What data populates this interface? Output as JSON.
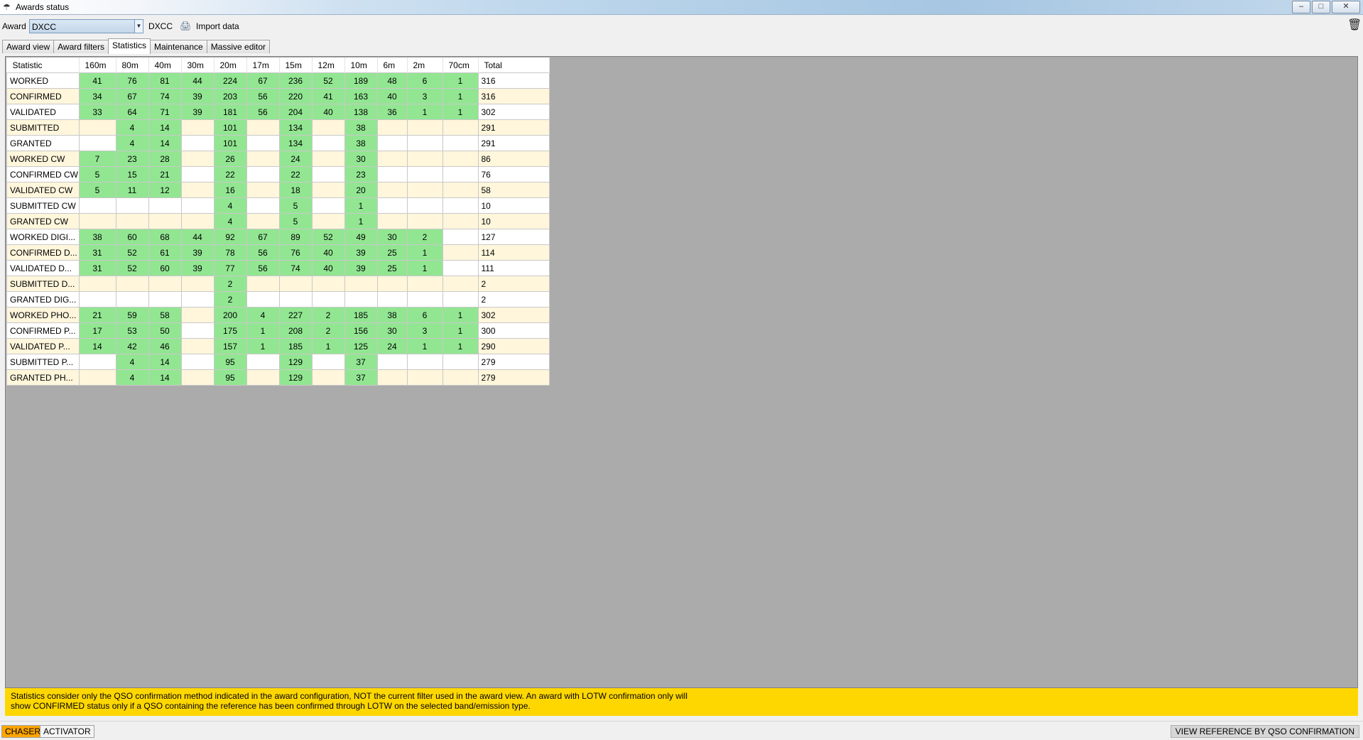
{
  "window": {
    "title": "Awards status"
  },
  "toolbar": {
    "award_label": "Award",
    "award_value": "DXCC",
    "award_name": "DXCC",
    "import_label": "Import data"
  },
  "tabs": [
    "Award view",
    "Award filters",
    "Statistics",
    "Maintenance",
    "Massive editor"
  ],
  "active_tab": "Statistics",
  "colors": {
    "confirmed_green": "#92e692",
    "stripe_cream": "#fff6dc",
    "info_yellow": "#ffd700",
    "chaser_orange": "#ffa500"
  },
  "table": {
    "columns": [
      "Statistic",
      "160m",
      "80m",
      "40m",
      "30m",
      "20m",
      "17m",
      "15m",
      "12m",
      "10m",
      "6m",
      "2m",
      "70cm",
      "Total"
    ],
    "rows": [
      {
        "name": "WORKED",
        "cells": [
          "41",
          "76",
          "81",
          "44",
          "224",
          "67",
          "236",
          "52",
          "189",
          "48",
          "6",
          "1"
        ],
        "total": "316"
      },
      {
        "name": "CONFIRMED",
        "cells": [
          "34",
          "67",
          "74",
          "39",
          "203",
          "56",
          "220",
          "41",
          "163",
          "40",
          "3",
          "1"
        ],
        "total": "316"
      },
      {
        "name": "VALIDATED",
        "cells": [
          "33",
          "64",
          "71",
          "39",
          "181",
          "56",
          "204",
          "40",
          "138",
          "36",
          "1",
          "1"
        ],
        "total": "302"
      },
      {
        "name": "SUBMITTED",
        "cells": [
          "",
          "4",
          "14",
          "",
          "101",
          "",
          "134",
          "",
          "38",
          "",
          "",
          ""
        ],
        "total": "291"
      },
      {
        "name": "GRANTED",
        "cells": [
          "",
          "4",
          "14",
          "",
          "101",
          "",
          "134",
          "",
          "38",
          "",
          "",
          ""
        ],
        "total": "291"
      },
      {
        "name": "WORKED CW",
        "cells": [
          "7",
          "23",
          "28",
          "",
          "26",
          "",
          "24",
          "",
          "30",
          "",
          "",
          ""
        ],
        "total": "86"
      },
      {
        "name": "CONFIRMED CW",
        "cells": [
          "5",
          "15",
          "21",
          "",
          "22",
          "",
          "22",
          "",
          "23",
          "",
          "",
          ""
        ],
        "total": "76"
      },
      {
        "name": "VALIDATED CW",
        "cells": [
          "5",
          "11",
          "12",
          "",
          "16",
          "",
          "18",
          "",
          "20",
          "",
          "",
          ""
        ],
        "total": "58"
      },
      {
        "name": "SUBMITTED CW",
        "cells": [
          "",
          "",
          "",
          "",
          "4",
          "",
          "5",
          "",
          "1",
          "",
          "",
          ""
        ],
        "total": "10"
      },
      {
        "name": "GRANTED CW",
        "cells": [
          "",
          "",
          "",
          "",
          "4",
          "",
          "5",
          "",
          "1",
          "",
          "",
          ""
        ],
        "total": "10"
      },
      {
        "name": "WORKED DIGI...",
        "cells": [
          "38",
          "60",
          "68",
          "44",
          "92",
          "67",
          "89",
          "52",
          "49",
          "30",
          "2",
          ""
        ],
        "total": "127"
      },
      {
        "name": "CONFIRMED D...",
        "cells": [
          "31",
          "52",
          "61",
          "39",
          "78",
          "56",
          "76",
          "40",
          "39",
          "25",
          "1",
          ""
        ],
        "total": "114"
      },
      {
        "name": "VALIDATED D...",
        "cells": [
          "31",
          "52",
          "60",
          "39",
          "77",
          "56",
          "74",
          "40",
          "39",
          "25",
          "1",
          ""
        ],
        "total": "111"
      },
      {
        "name": "SUBMITTED D...",
        "cells": [
          "",
          "",
          "",
          "",
          "2",
          "",
          "",
          "",
          "",
          "",
          "",
          ""
        ],
        "total": "2"
      },
      {
        "name": "GRANTED DIG...",
        "cells": [
          "",
          "",
          "",
          "",
          "2",
          "",
          "",
          "",
          "",
          "",
          "",
          ""
        ],
        "total": "2"
      },
      {
        "name": "WORKED PHO...",
        "cells": [
          "21",
          "59",
          "58",
          "",
          "200",
          "4",
          "227",
          "2",
          "185",
          "38",
          "6",
          "1"
        ],
        "total": "302"
      },
      {
        "name": "CONFIRMED P...",
        "cells": [
          "17",
          "53",
          "50",
          "",
          "175",
          "1",
          "208",
          "2",
          "156",
          "30",
          "3",
          "1"
        ],
        "total": "300"
      },
      {
        "name": "VALIDATED P...",
        "cells": [
          "14",
          "42",
          "46",
          "",
          "157",
          "1",
          "185",
          "1",
          "125",
          "24",
          "1",
          "1"
        ],
        "total": "290"
      },
      {
        "name": "SUBMITTED P...",
        "cells": [
          "",
          "4",
          "14",
          "",
          "95",
          "",
          "129",
          "",
          "37",
          "",
          "",
          ""
        ],
        "total": "279"
      },
      {
        "name": "GRANTED PH...",
        "cells": [
          "",
          "4",
          "14",
          "",
          "95",
          "",
          "129",
          "",
          "37",
          "",
          "",
          ""
        ],
        "total": "279"
      }
    ]
  },
  "info_text_line1": "Statistics consider only the QSO confirmation method indicated in the award configuration, NOT the current filter used in the award view. An award with LOTW confirmation only will",
  "info_text_line2": "show CONFIRMED status only if a QSO containing the reference has been confirmed through LOTW on the selected band/emission type.",
  "statusbar": {
    "mode_chaser": "CHASER",
    "mode_activator": "ACTIVATOR",
    "view_reference": "VIEW REFERENCE BY QSO CONFIRMATION"
  },
  "icons": [
    "app-icon",
    "dropdown-arrow-icon",
    "import-data-icon",
    "trash-icon",
    "minimize-icon",
    "maximize-icon",
    "close-icon"
  ]
}
